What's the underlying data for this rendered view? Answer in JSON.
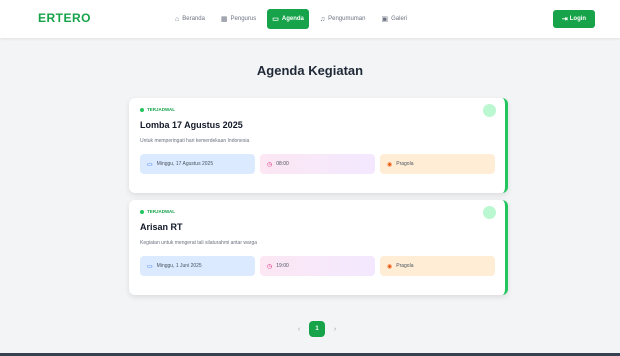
{
  "brand": "ERTERO",
  "nav": {
    "items": [
      {
        "label": "Beranda",
        "icon": "home-icon",
        "glyph": "⌂"
      },
      {
        "label": "Pengurus",
        "icon": "users-icon",
        "glyph": "▦"
      },
      {
        "label": "Agenda",
        "icon": "calendar-icon",
        "glyph": "▭",
        "active": true
      },
      {
        "label": "Pengumuman",
        "icon": "bell-icon",
        "glyph": "♫"
      },
      {
        "label": "Galeri",
        "icon": "image-icon",
        "glyph": "▣"
      }
    ],
    "login_label": "Login",
    "login_glyph": "⇥"
  },
  "page_title": "Agenda Kegiatan",
  "events": [
    {
      "status": "TERJADWAL",
      "title": "Lomba 17 Agustus 2025",
      "description": "Untuk memperingati hari kemerdekaan Indonesia",
      "date": "Minggu, 17 Agustus 2025",
      "time": "08:00",
      "place": "Pragola"
    },
    {
      "status": "TERJADWAL",
      "title": "Arisan RT",
      "description": "Kegiatan untuk mengerat tali silaturahmi antar warga",
      "date": "Minggu, 1 Juni 2025",
      "time": "19:00",
      "place": "Pragola"
    }
  ],
  "pagination": {
    "prev": "‹",
    "current": "1",
    "next": "›"
  },
  "colors": {
    "accent": "#16a34a",
    "accent_light": "#22c55e"
  }
}
